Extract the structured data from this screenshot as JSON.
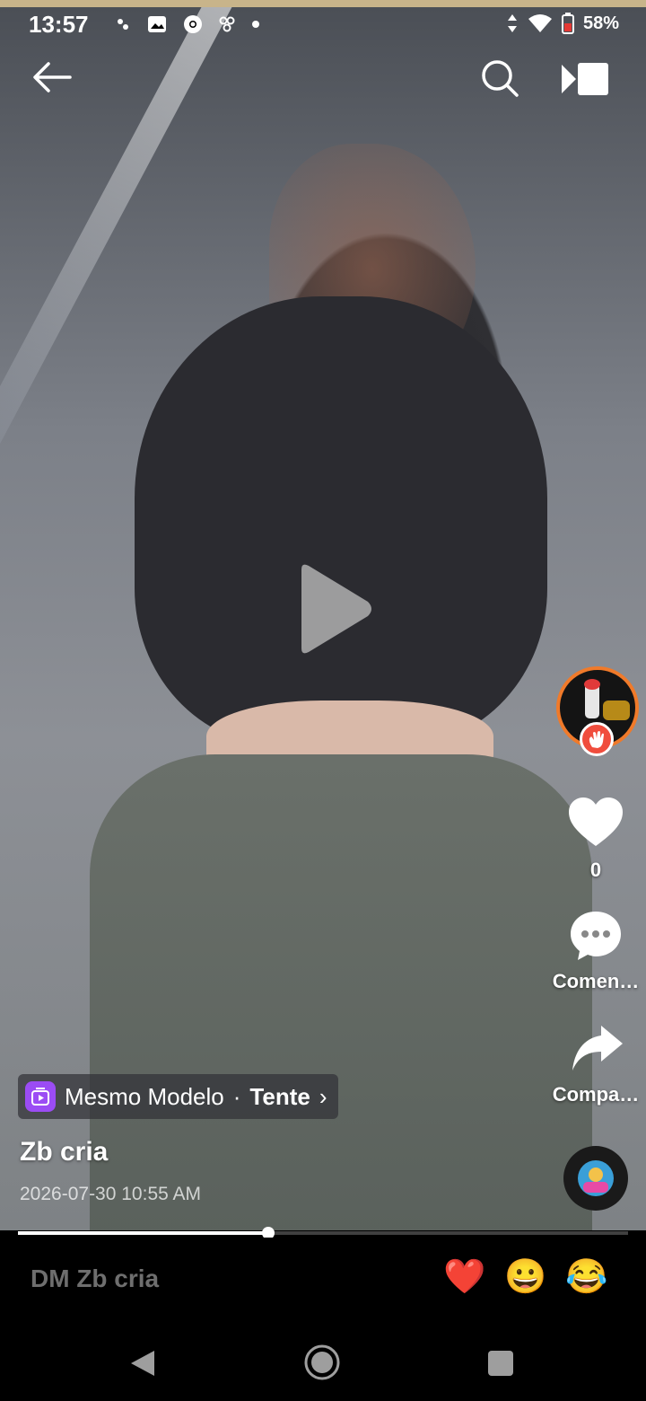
{
  "status_bar": {
    "time": "13:57",
    "battery": "58%"
  },
  "post": {
    "template_chip": {
      "label": "Mesmo Modelo",
      "separator": "·",
      "action": "Tente",
      "chevron": "›"
    },
    "username": "Zb cria",
    "timestamp": "2026-07-30 10:55 AM",
    "progress": 0.41
  },
  "actions": {
    "like_count": "0",
    "comment_label": "Comen…",
    "share_label": "Compa…"
  },
  "dm_bar": {
    "placeholder": "DM Zb cria",
    "emojis": [
      "❤️",
      "😀",
      "😂"
    ]
  },
  "colors": {
    "avatar_ring": "#f07a2a",
    "template_icon": "#9b4cf4",
    "wave_badge": "#f04d3d"
  }
}
